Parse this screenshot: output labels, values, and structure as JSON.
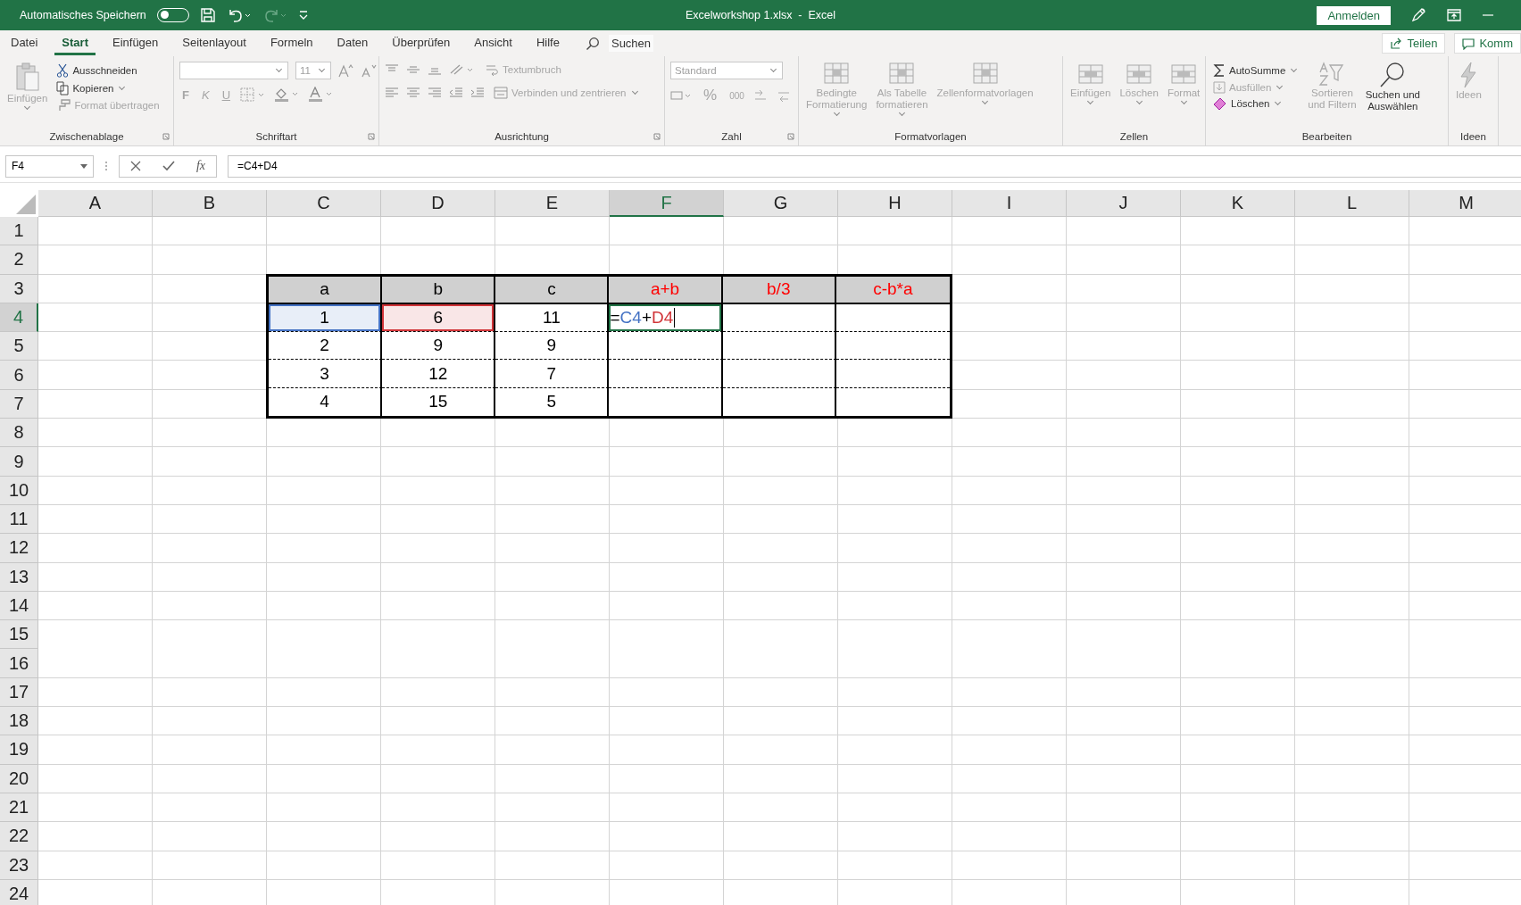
{
  "title_bar": {
    "autosave_label": "Automatisches Speichern",
    "autosave_on": false,
    "title": "Excelworkshop 1.xlsx  -  Excel",
    "sign_in": "Anmelden"
  },
  "tabs": [
    {
      "label": "Datei",
      "selected": false
    },
    {
      "label": "Start",
      "selected": true
    },
    {
      "label": "Einfügen",
      "selected": false
    },
    {
      "label": "Seitenlayout",
      "selected": false
    },
    {
      "label": "Formeln",
      "selected": false
    },
    {
      "label": "Daten",
      "selected": false
    },
    {
      "label": "Überprüfen",
      "selected": false
    },
    {
      "label": "Ansicht",
      "selected": false
    },
    {
      "label": "Hilfe",
      "selected": false
    }
  ],
  "search": {
    "label": "Suchen"
  },
  "share": "Teilen",
  "comments": "Komm",
  "ribbon": {
    "groups": [
      {
        "label": "Zwischenablage",
        "items": [
          {
            "lines": [
              "Einfügen"
            ],
            "disabled": true
          },
          {
            "lines": [
              "Ausschneiden"
            ],
            "disabled": false
          },
          {
            "lines": [
              "Kopieren"
            ],
            "disabled": false
          },
          {
            "lines": [
              "Format übertragen"
            ],
            "disabled": true
          }
        ]
      },
      {
        "label": "Schriftart",
        "items": [
          {
            "lines": [
              "11"
            ],
            "disabled": true
          },
          {
            "lines": [
              "F"
            ],
            "disabled": true
          },
          {
            "lines": [
              "K"
            ],
            "disabled": true
          },
          {
            "lines": [
              "U"
            ],
            "disabled": true
          }
        ]
      },
      {
        "label": "Ausrichtung",
        "items": [
          {
            "lines": [
              "Textumbruch"
            ],
            "disabled": true
          },
          {
            "lines": [
              "Verbinden und zentrieren"
            ],
            "disabled": true
          }
        ]
      },
      {
        "label": "Zahl",
        "items": [
          {
            "lines": [
              "Standard"
            ],
            "disabled": true
          },
          {
            "lines": [
              "%"
            ],
            "disabled": true
          },
          {
            "lines": [
              "000"
            ],
            "disabled": true
          }
        ]
      },
      {
        "label": "Formatvorlagen",
        "items": [
          {
            "lines": [
              "Bedingte",
              "Formatierung"
            ],
            "disabled": true
          },
          {
            "lines": [
              "Als Tabelle",
              "formatieren"
            ],
            "disabled": true
          },
          {
            "lines": [
              "Zellenformatvorlagen"
            ],
            "disabled": true
          }
        ]
      },
      {
        "label": "Zellen",
        "items": [
          {
            "lines": [
              "Einfügen"
            ],
            "disabled": true
          },
          {
            "lines": [
              "Löschen"
            ],
            "disabled": true
          },
          {
            "lines": [
              "Format"
            ],
            "disabled": true
          }
        ]
      },
      {
        "label": "Bearbeiten",
        "items": [
          {
            "lines": [
              "AutoSumme"
            ],
            "disabled": false
          },
          {
            "lines": [
              "Ausfüllen"
            ],
            "disabled": true
          },
          {
            "lines": [
              "Löschen"
            ],
            "disabled": false
          },
          {
            "lines": [
              "Sortieren",
              "und Filtern"
            ],
            "disabled": true
          },
          {
            "lines": [
              "Suchen und",
              "Auswählen"
            ],
            "disabled": false
          }
        ]
      },
      {
        "label": "Ideen",
        "items": [
          {
            "lines": [
              "Ideen"
            ],
            "disabled": true
          }
        ]
      }
    ]
  },
  "formula_bar": {
    "name_box": "F4",
    "fx": "fx",
    "formula": "=C4+D4"
  },
  "columns": [
    {
      "label": "A",
      "selected": false
    },
    {
      "label": "B",
      "selected": false
    },
    {
      "label": "C",
      "selected": false
    },
    {
      "label": "D",
      "selected": false
    },
    {
      "label": "E",
      "selected": false
    },
    {
      "label": "F",
      "selected": true
    },
    {
      "label": "G",
      "selected": false
    },
    {
      "label": "H",
      "selected": false
    },
    {
      "label": "I",
      "selected": false
    },
    {
      "label": "J",
      "selected": false
    },
    {
      "label": "K",
      "selected": false
    },
    {
      "label": "L",
      "selected": false
    },
    {
      "label": "M",
      "selected": false
    }
  ],
  "rows": [
    {
      "label": "1",
      "selected": false
    },
    {
      "label": "2",
      "selected": false
    },
    {
      "label": "3",
      "selected": false
    },
    {
      "label": "4",
      "selected": true
    },
    {
      "label": "5",
      "selected": false
    },
    {
      "label": "6",
      "selected": false
    },
    {
      "label": "7",
      "selected": false
    },
    {
      "label": "8",
      "selected": false
    },
    {
      "label": "9",
      "selected": false
    },
    {
      "label": "10",
      "selected": false
    },
    {
      "label": "11",
      "selected": false
    },
    {
      "label": "12",
      "selected": false
    },
    {
      "label": "13",
      "selected": false
    },
    {
      "label": "14",
      "selected": false
    },
    {
      "label": "15",
      "selected": false
    },
    {
      "label": "16",
      "selected": false
    },
    {
      "label": "17",
      "selected": false
    },
    {
      "label": "18",
      "selected": false
    },
    {
      "label": "19",
      "selected": false
    },
    {
      "label": "20",
      "selected": false
    },
    {
      "label": "21",
      "selected": false
    },
    {
      "label": "22",
      "selected": false
    },
    {
      "label": "23",
      "selected": false
    },
    {
      "label": "24",
      "selected": false
    }
  ],
  "table": {
    "header": [
      {
        "text": "a",
        "color": "#000000"
      },
      {
        "text": "b",
        "color": "#000000"
      },
      {
        "text": "c",
        "color": "#000000"
      },
      {
        "text": "a+b",
        "color": "#ff0000"
      },
      {
        "text": "b/3",
        "color": "#ff0000"
      },
      {
        "text": "c-b*a",
        "color": "#ff0000"
      }
    ],
    "rows": [
      {
        "cells": [
          {
            "kind": "value",
            "value": "1",
            "color": "#4472c4"
          },
          {
            "kind": "value",
            "value": "6",
            "color": "#d13438"
          },
          {
            "kind": "value",
            "value": "11"
          },
          {
            "kind": "editing",
            "parts": [
              {
                "text": "=",
                "color": "#000000"
              },
              {
                "text": "C4",
                "color": "#4472c4"
              },
              {
                "text": "+",
                "color": "#000000"
              },
              {
                "text": "D4",
                "color": "#d13438"
              }
            ]
          },
          {
            "kind": "empty"
          },
          {
            "kind": "empty"
          }
        ]
      },
      {
        "cells": [
          {
            "kind": "value",
            "value": "2"
          },
          {
            "kind": "value",
            "value": "9"
          },
          {
            "kind": "value",
            "value": "9"
          },
          {
            "kind": "empty"
          },
          {
            "kind": "empty"
          },
          {
            "kind": "empty"
          }
        ]
      },
      {
        "cells": [
          {
            "kind": "value",
            "value": "3"
          },
          {
            "kind": "value",
            "value": "12"
          },
          {
            "kind": "value",
            "value": "7"
          },
          {
            "kind": "empty"
          },
          {
            "kind": "empty"
          },
          {
            "kind": "empty"
          }
        ]
      },
      {
        "cells": [
          {
            "kind": "value",
            "value": "4"
          },
          {
            "kind": "value",
            "value": "15"
          },
          {
            "kind": "value",
            "value": "5"
          },
          {
            "kind": "empty"
          },
          {
            "kind": "empty"
          },
          {
            "kind": "empty"
          }
        ]
      }
    ]
  }
}
